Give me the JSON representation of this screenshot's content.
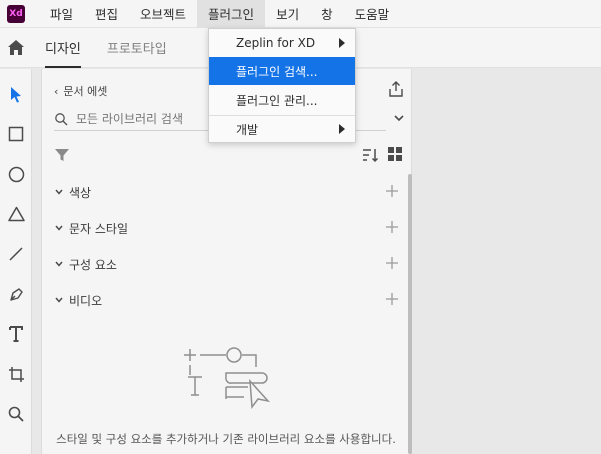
{
  "app": {
    "logo_text": "Xd"
  },
  "menubar": {
    "items": [
      {
        "label": "파일"
      },
      {
        "label": "편집"
      },
      {
        "label": "오브젝트"
      },
      {
        "label": "플러그인"
      },
      {
        "label": "보기"
      },
      {
        "label": "창"
      },
      {
        "label": "도움말"
      }
    ]
  },
  "tabs": [
    {
      "label": "디자인",
      "active": true
    },
    {
      "label": "프로토타입",
      "active": false
    }
  ],
  "panel": {
    "back_label": "문서 에셋",
    "search_placeholder": "모든 라이브러리 검색",
    "sections": [
      {
        "label": "색상"
      },
      {
        "label": "문자 스타일"
      },
      {
        "label": "구성 요소"
      },
      {
        "label": "비디오"
      }
    ],
    "empty_text": "스타일 및 구성 요소를 추가하거나 기존 라이브러리 요소를 사용합니다."
  },
  "plugins_menu": {
    "items": [
      {
        "label": "Zeplin for XD",
        "submenu": true
      },
      {
        "label": "플러그인 검색...",
        "submenu": false,
        "highlighted": true
      },
      {
        "label": "플러그인 관리...",
        "submenu": false
      },
      {
        "label": "개발",
        "submenu": true
      }
    ]
  },
  "colors": {
    "accent": "#1473e6",
    "tool_selected": "#1473e6",
    "brand_bg": "#470137",
    "brand_fg": "#ff61f6"
  },
  "icons": {
    "home": "home-icon",
    "select": "select-arrow-icon",
    "rectangle": "rectangle-icon",
    "ellipse": "ellipse-icon",
    "polygon": "triangle-icon",
    "line": "line-icon",
    "pen": "pen-icon",
    "text": "text-icon",
    "artboard": "artboard-icon",
    "zoom": "zoom-icon"
  }
}
